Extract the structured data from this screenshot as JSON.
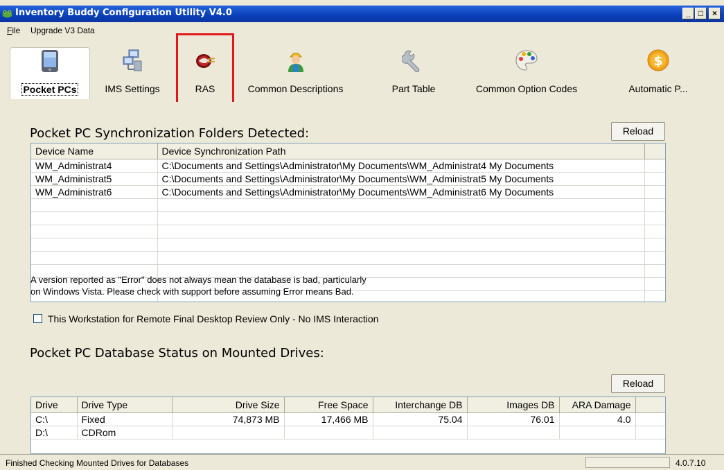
{
  "window": {
    "title": "Inventory Buddy Configuration Utility V4.0",
    "controls": {
      "minimize": "_",
      "maximize": "□",
      "close": "×"
    }
  },
  "menu": [
    {
      "label": "File",
      "accel": "F",
      "rest": "ile"
    },
    {
      "label": "Upgrade V3 Data"
    }
  ],
  "tabs": [
    {
      "label": "Pocket PCs",
      "icon": "pocket-pc-icon",
      "active": true
    },
    {
      "label": "IMS Settings",
      "icon": "network-computers-icon"
    },
    {
      "label": "RAS",
      "icon": "ras-logo-icon",
      "highlighted": true
    },
    {
      "label": "Common Descriptions",
      "icon": "worker-icon"
    },
    {
      "label": "Part Table",
      "icon": "wrench-icon"
    },
    {
      "label": "Common Option Codes",
      "icon": "palette-icon"
    },
    {
      "label": "Automatic P...",
      "icon": "dollar-coin-icon"
    }
  ],
  "tab_scroll": "◄ ►",
  "sync": {
    "title": "Pocket PC Synchronization Folders Detected:",
    "reload_label": "Reload",
    "columns": [
      "Device Name",
      "Device Synchronization Path"
    ],
    "rows": [
      [
        "WM_Administrat4",
        "C:\\Documents and Settings\\Administrator\\My Documents\\WM_Administrat4 My Documents"
      ],
      [
        "WM_Administrat5",
        "C:\\Documents and Settings\\Administrator\\My Documents\\WM_Administrat5 My Documents"
      ],
      [
        "WM_Administrat6",
        "C:\\Documents and Settings\\Administrator\\My Documents\\WM_Administrat6 My Documents"
      ]
    ]
  },
  "remote_review": {
    "label": "This Workstation for Remote Final Desktop Review Only - No IMS Interaction",
    "checked": false
  },
  "db_status": {
    "title": "Pocket PC Database Status on Mounted Drives:",
    "note_line1": "A version reported as \"Error\" does not always mean the database is bad, particularly",
    "note_line2": "on Windows Vista.  Please check with support before assuming Error means Bad.",
    "reload_label": "Reload",
    "columns": [
      "Drive",
      "Drive Type",
      "Drive Size",
      "Free Space",
      "Interchange DB",
      "Images DB",
      "ARA Damage"
    ],
    "rows": [
      [
        "C:\\",
        "Fixed",
        "74,873 MB",
        "17,466 MB",
        "75.04",
        "76.01",
        "4.0"
      ],
      [
        "D:\\",
        "CDRom",
        "",
        "",
        "",
        "",
        ""
      ]
    ]
  },
  "status": {
    "message": "Finished Checking Mounted Drives for Databases",
    "version": "4.0.7.10"
  }
}
